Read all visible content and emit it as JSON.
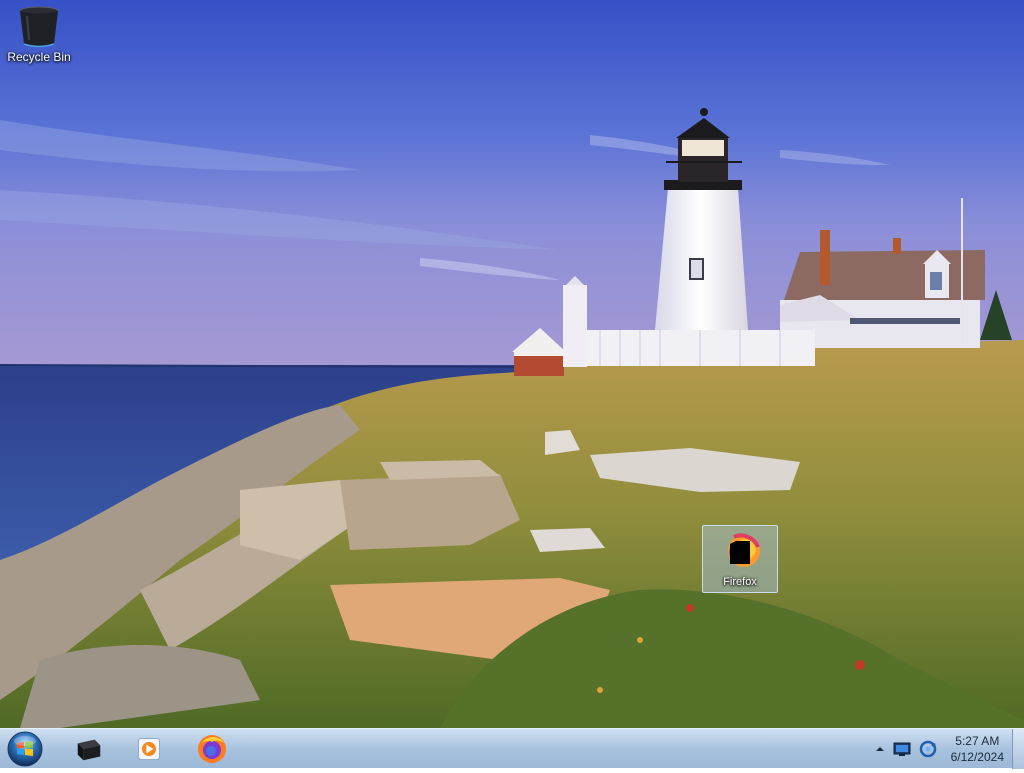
{
  "desktop": {
    "icons": [
      {
        "label": "Recycle Bin",
        "icon": "recycle-bin-icon"
      },
      {
        "label": "Firefox",
        "icon": "firefox-shortcut-icon"
      }
    ]
  },
  "taskbar": {
    "start_icon": "windows-orb-icon",
    "pinned": [
      {
        "icon": "terminal-icon"
      },
      {
        "icon": "media-player-icon"
      },
      {
        "icon": "firefox-icon"
      }
    ],
    "tray": {
      "icons": [
        "show-hidden-icons-arrow",
        "network-icon",
        "update-icon"
      ],
      "time": "5:27 AM",
      "date": "6/12/2024"
    }
  },
  "colors": {
    "taskbar_top": "#cfe0f1",
    "taskbar_bottom": "#9bb8d6",
    "sky_top": "#3d58c8",
    "sea": "#2a3f86"
  }
}
